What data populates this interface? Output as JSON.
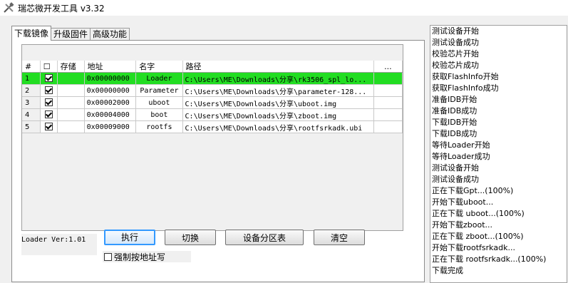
{
  "window": {
    "title": "瑞芯微开发工具 v3.32"
  },
  "tabs": [
    {
      "label": "下载镜像",
      "active": true
    },
    {
      "label": "升级固件",
      "active": false
    },
    {
      "label": "高级功能",
      "active": false
    }
  ],
  "table": {
    "columns": [
      "#",
      "☐",
      "存储",
      "地址",
      "名字",
      "路径",
      "..."
    ],
    "rows": [
      {
        "num": "1",
        "checked": true,
        "storage": "",
        "address": "0x00000000",
        "name": "Loader",
        "path": "C:\\Users\\ME\\Downloads\\分享\\rk3506_spl_lo...",
        "selected": true
      },
      {
        "num": "2",
        "checked": true,
        "storage": "",
        "address": "0x00000000",
        "name": "Parameter",
        "path": "C:\\Users\\ME\\Downloads\\分享\\parameter-128...",
        "selected": false
      },
      {
        "num": "3",
        "checked": true,
        "storage": "",
        "address": "0x00002000",
        "name": "uboot",
        "path": "C:\\Users\\ME\\Downloads\\分享\\uboot.img",
        "selected": false
      },
      {
        "num": "4",
        "checked": true,
        "storage": "",
        "address": "0x00004000",
        "name": "boot",
        "path": "C:\\Users\\ME\\Downloads\\分享\\zboot.img",
        "selected": false
      },
      {
        "num": "5",
        "checked": true,
        "storage": "",
        "address": "0x00009000",
        "name": "rootfs",
        "path": "C:\\Users\\ME\\Downloads\\分享\\rootfsrkadk.ubi",
        "selected": false
      }
    ]
  },
  "loader_version": "Loader Ver:1.01",
  "buttons": {
    "execute": "执行",
    "switch": "切换",
    "partition_table": "设备分区表",
    "clear": "清空"
  },
  "force_address": {
    "label": "强制按地址写",
    "checked": false
  },
  "log": [
    "测试设备开始",
    "测试设备成功",
    "校验芯片开始",
    "校验芯片成功",
    "获取FlashInfo开始",
    "获取FlashInfo成功",
    "准备IDB开始",
    "准备IDB成功",
    "下载IDB开始",
    "下载IDB成功",
    "等待Loader开始",
    "等待Loader成功",
    "测试设备开始",
    "测试设备成功",
    "正在下载Gpt...(100%)",
    "开始下载uboot...",
    "正在下载 uboot...(100%)",
    "开始下载zboot...",
    "正在下载 zboot...(100%)",
    "开始下载rootfsrkadk...",
    "正在下载 rootfsrkadk...(100%)",
    "下载完成"
  ],
  "colors": {
    "selected_row": "#22dd22",
    "accent": "#3399ff"
  }
}
